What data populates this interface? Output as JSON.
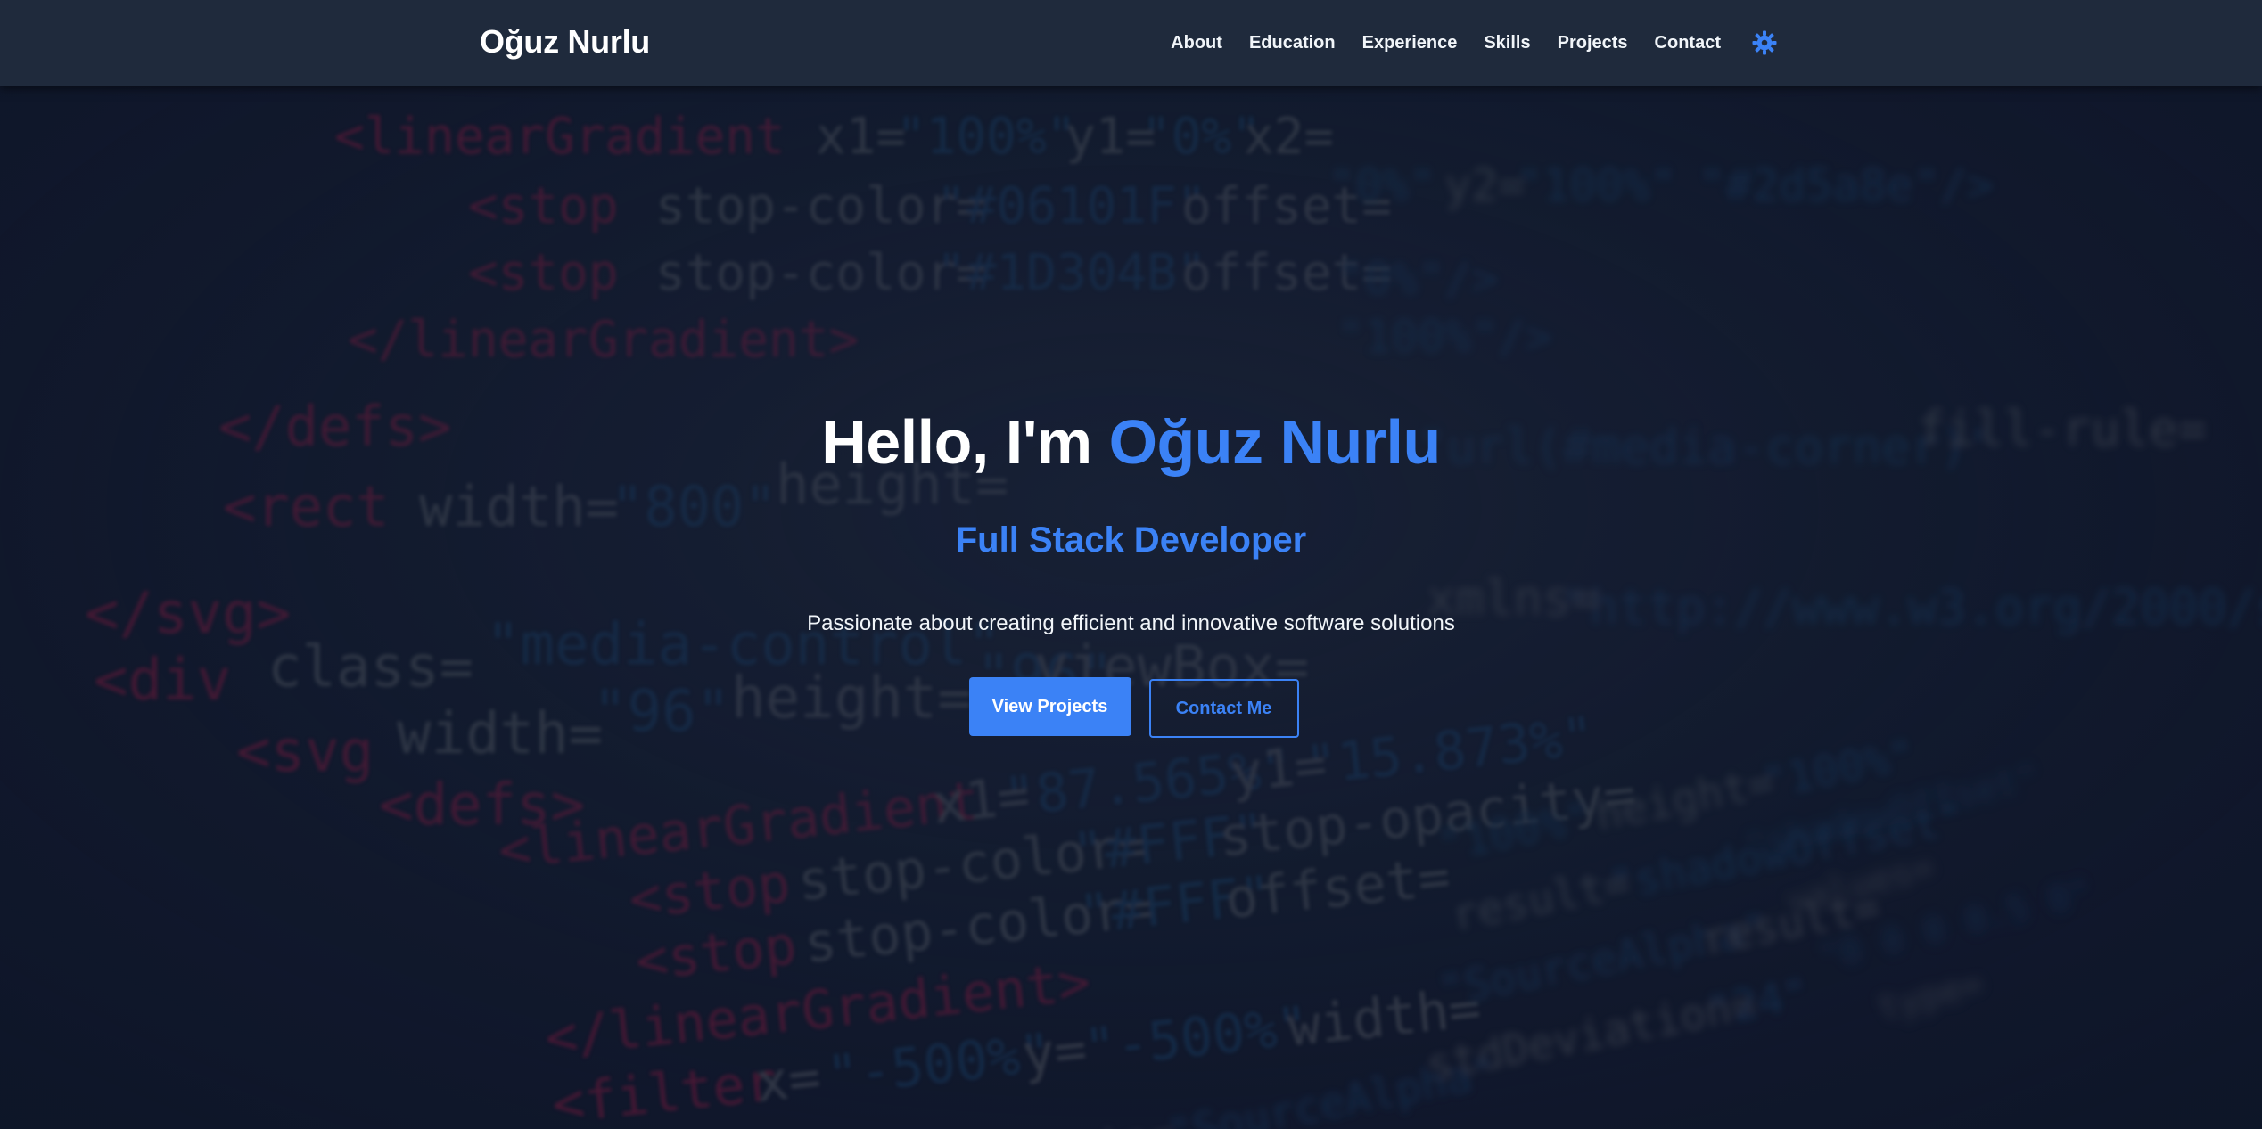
{
  "navbar": {
    "brand": "Oğuz Nurlu",
    "links": [
      "About",
      "Education",
      "Experience",
      "Skills",
      "Projects",
      "Contact"
    ],
    "theme_toggle_icon": "gear-icon"
  },
  "hero": {
    "greeting": "Hello, I'm ",
    "name": "Oğuz Nurlu",
    "subtitle": "Full Stack Developer",
    "description": "Passionate about creating efficient and innovative software solutions",
    "primary_button": "View Projects",
    "secondary_button": "Contact Me"
  },
  "colors": {
    "accent": "#3b82f6",
    "navbar_bg": "#1f2a3c",
    "page_bg": "#0f172a",
    "text": "#ffffff"
  }
}
